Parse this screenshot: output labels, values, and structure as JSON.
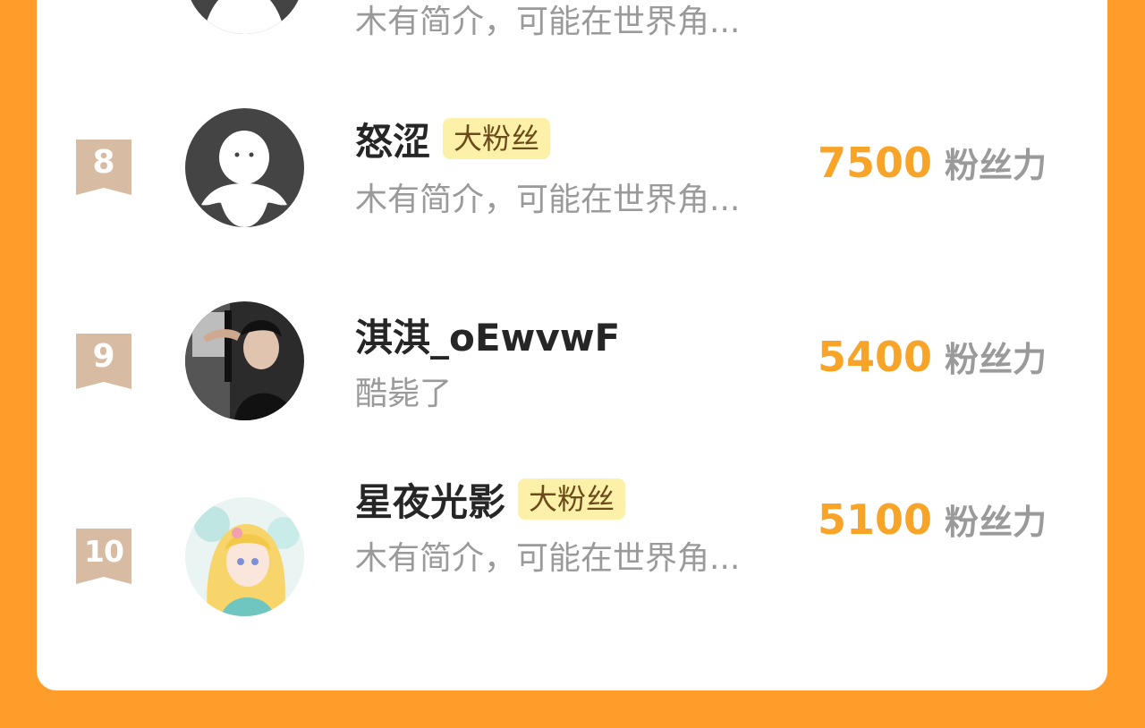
{
  "fans": [
    {
      "rank": "",
      "name": "",
      "bio": "木有简介，可能在世界角...",
      "badge": "",
      "score": "",
      "unit": "",
      "avatar": "default-avatar"
    },
    {
      "rank": "8",
      "name": "怒涩",
      "bio": "木有简介，可能在世界角...",
      "badge": "大粉丝",
      "score": "7500",
      "unit": "粉丝力",
      "avatar": "default-avatar"
    },
    {
      "rank": "9",
      "name": "淇淇_oEwvwF",
      "bio": "酷毙了",
      "badge": "",
      "score": "5400",
      "unit": "粉丝力",
      "avatar": "photo-avatar"
    },
    {
      "rank": "10",
      "name": "星夜光影",
      "bio": "木有简介，可能在世界角...",
      "badge": "大粉丝",
      "score": "5100",
      "unit": "粉丝力",
      "avatar": "anime-avatar"
    }
  ],
  "colors": {
    "background": "#ff9d2a",
    "score": "#f7a428",
    "rank_badge": "#d6b9a2",
    "fan_badge_bg": "#fdf0a8"
  }
}
